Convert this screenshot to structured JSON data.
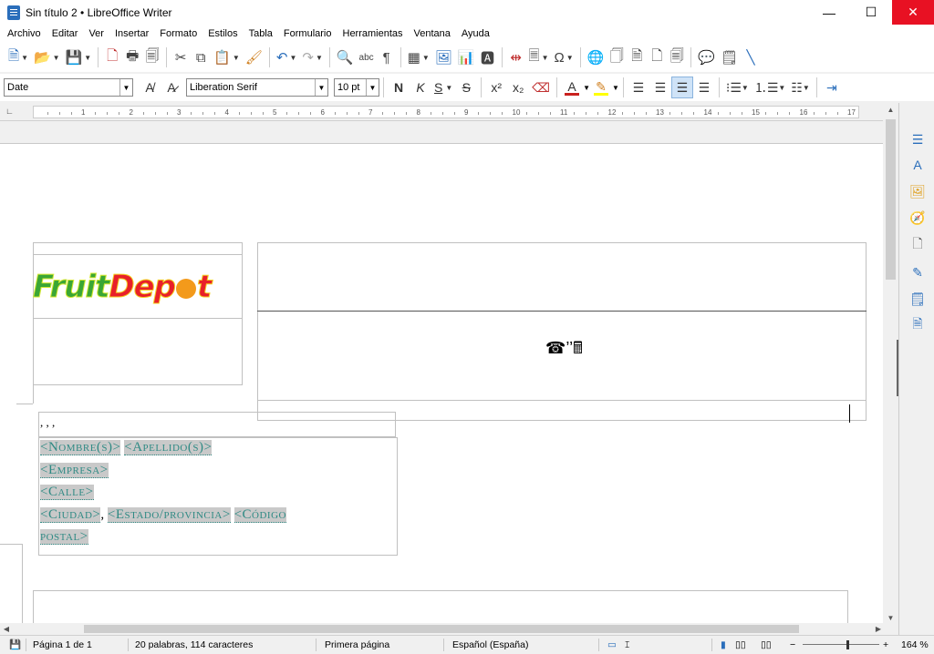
{
  "window": {
    "title": "Sin título 2 • LibreOffice Writer",
    "minimize": "—",
    "maximize": "☐",
    "close": "✕"
  },
  "menu": [
    "Archivo",
    "Editar",
    "Ver",
    "Insertar",
    "Formato",
    "Estilos",
    "Tabla",
    "Formulario",
    "Herramientas",
    "Ventana",
    "Ayuda"
  ],
  "toolbar2": {
    "paragraph_style": "Date",
    "font_name": "Liberation Serif",
    "font_size": "10 pt",
    "bold": "N",
    "italic": "K",
    "underline": "S",
    "strike": "S",
    "superscript": "x²",
    "subscript": "x₂"
  },
  "ruler": {
    "labels": [
      "1",
      "2",
      "3",
      "4",
      "5",
      "6",
      "7",
      "8",
      "9",
      "10",
      "11",
      "12",
      "13",
      "14",
      "15",
      "16",
      "17"
    ]
  },
  "document": {
    "commas": ", , ,",
    "phone_glyph": "☎︎’’🖩",
    "address": {
      "nombre": "<Nombre(s)>",
      "apellido": "<Apellido(s)>",
      "empresa": "<Empresa>",
      "calle": "<Calle>",
      "ciudad": "<Ciudad>",
      "sep1": ",",
      "estado": "<Estado/provincia>",
      "codigo_a": "<Código",
      "codigo_b": "postal>"
    },
    "logo": {
      "part1": "Fruit",
      "part2": "Dep",
      "part3": "t"
    }
  },
  "status": {
    "page": "Página 1 de 1",
    "words": "20 palabras, 114 caracteres",
    "page_style": "Primera página",
    "language": "Español (España)",
    "zoom": "164 %",
    "zoom_minus": "−",
    "zoom_plus": "+"
  },
  "colors": {
    "font_color_bar": "#c9211e",
    "highlight_bar": "#ffff00",
    "field_text": "#2f8a84",
    "close_button": "#e81123"
  }
}
